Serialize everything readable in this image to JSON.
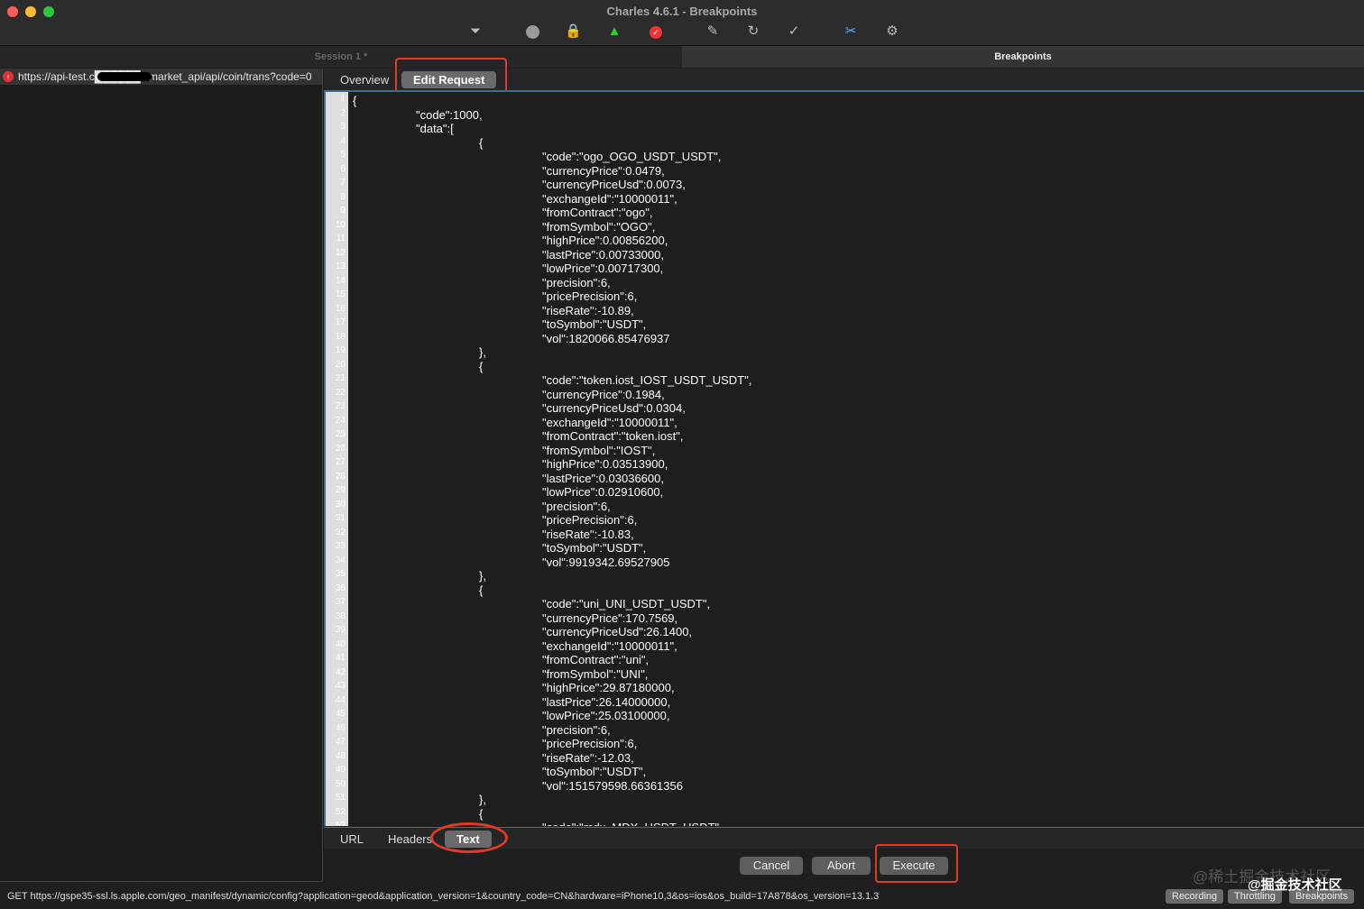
{
  "window": {
    "title": "Charles 4.6.1 - Breakpoints"
  },
  "toolbar": [
    "broom-icon",
    "record-icon",
    "ssl-lock-icon",
    "throttle-turtle-icon",
    "breakpoint-icon",
    "compose-pen-icon",
    "repeat-icon",
    "validate-check-icon",
    "tools-icon",
    "settings-gear-icon"
  ],
  "tabs": {
    "session": "Session 1 *",
    "breakpoints": "Breakpoints"
  },
  "request_list": {
    "url": "https://api-test.c██████s/market_api/api/coin/trans?code=0"
  },
  "subtabs": {
    "overview": "Overview",
    "edit_request": "Edit Request"
  },
  "editor": {
    "lines": [
      "{",
      "\t\"code\":1000,",
      "\t\"data\":[",
      "\t\t{",
      "\t\t\t\"code\":\"ogo_OGO_USDT_USDT\",",
      "\t\t\t\"currencyPrice\":0.0479,",
      "\t\t\t\"currencyPriceUsd\":0.0073,",
      "\t\t\t\"exchangeId\":\"10000011\",",
      "\t\t\t\"fromContract\":\"ogo\",",
      "\t\t\t\"fromSymbol\":\"OGO\",",
      "\t\t\t\"highPrice\":0.00856200,",
      "\t\t\t\"lastPrice\":0.00733000,",
      "\t\t\t\"lowPrice\":0.00717300,",
      "\t\t\t\"precision\":6,",
      "\t\t\t\"pricePrecision\":6,",
      "\t\t\t\"riseRate\":-10.89,",
      "\t\t\t\"toSymbol\":\"USDT\",",
      "\t\t\t\"vol\":1820066.85476937",
      "\t\t},",
      "\t\t{",
      "\t\t\t\"code\":\"token.iost_IOST_USDT_USDT\",",
      "\t\t\t\"currencyPrice\":0.1984,",
      "\t\t\t\"currencyPriceUsd\":0.0304,",
      "\t\t\t\"exchangeId\":\"10000011\",",
      "\t\t\t\"fromContract\":\"token.iost\",",
      "\t\t\t\"fromSymbol\":\"IOST\",",
      "\t\t\t\"highPrice\":0.03513900,",
      "\t\t\t\"lastPrice\":0.03036600,",
      "\t\t\t\"lowPrice\":0.02910600,",
      "\t\t\t\"precision\":6,",
      "\t\t\t\"pricePrecision\":6,",
      "\t\t\t\"riseRate\":-10.83,",
      "\t\t\t\"toSymbol\":\"USDT\",",
      "\t\t\t\"vol\":9919342.69527905",
      "\t\t},",
      "\t\t{",
      "\t\t\t\"code\":\"uni_UNI_USDT_USDT\",",
      "\t\t\t\"currencyPrice\":170.7569,",
      "\t\t\t\"currencyPriceUsd\":26.1400,",
      "\t\t\t\"exchangeId\":\"10000011\",",
      "\t\t\t\"fromContract\":\"uni\",",
      "\t\t\t\"fromSymbol\":\"UNI\",",
      "\t\t\t\"highPrice\":29.87180000,",
      "\t\t\t\"lastPrice\":26.14000000,",
      "\t\t\t\"lowPrice\":25.03100000,",
      "\t\t\t\"precision\":6,",
      "\t\t\t\"pricePrecision\":6,",
      "\t\t\t\"riseRate\":-12.03,",
      "\t\t\t\"toSymbol\":\"USDT\",",
      "\t\t\t\"vol\":151579598.66361356",
      "\t\t},",
      "\t\t{",
      "\t\t\t\"code\":\"mdx_MDX_USDT_USDT\""
    ]
  },
  "bottom_tabs": {
    "url": "URL",
    "headers": "Headers",
    "text": "Text"
  },
  "actions": {
    "cancel": "Cancel",
    "abort": "Abort",
    "execute": "Execute"
  },
  "status": {
    "text": "GET https://gspe35-ssl.ls.apple.com/geo_manifest/dynamic/config?application=geod&application_version=1&country_code=CN&hardware=iPhone10,3&os=ios&os_build=17A878&os_version=13.1.3",
    "recording": "Recording",
    "throttling": "Throttling",
    "breakpoints": "Breakpoints"
  },
  "watermark": {
    "a": "@稀土掘金技术社区",
    "b": "@掘金技术社区"
  }
}
